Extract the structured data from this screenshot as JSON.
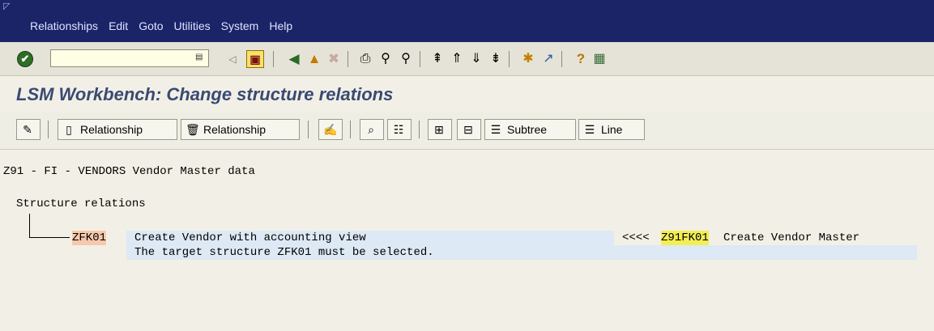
{
  "menubar": {
    "items": [
      {
        "label": "Relationships"
      },
      {
        "label": "Edit"
      },
      {
        "label": "Goto"
      },
      {
        "label": "Utilities"
      },
      {
        "label": "System"
      },
      {
        "label": "Help"
      }
    ]
  },
  "std_toolbar": {
    "command_field_value": "",
    "icons": [
      "enter-icon",
      "save-icon",
      "back-icon",
      "exit-icon",
      "cancel-icon",
      "print-icon",
      "find-icon",
      "find-next-icon",
      "first-page-icon",
      "previous-page-icon",
      "next-page-icon",
      "last-page-icon",
      "create-session-icon",
      "shortcut-icon",
      "help-icon",
      "layout-menu-icon"
    ]
  },
  "title": "LSM Workbench: Change structure relations",
  "app_toolbar": {
    "create_relationship": "Relationship",
    "delete_relationship": "Relationship",
    "subtree": "Subtree",
    "line": "Line"
  },
  "content": {
    "header": "Z91 - FI - VENDORS Vendor Master data",
    "section": "Structure relations",
    "target_code": "ZFK01",
    "target_desc": "Create Vendor with accounting view",
    "arrow": "<<<<",
    "source_code": "Z91FK01",
    "source_desc": "Create Vendor Master",
    "message": "The target structure ZFK01 must be selected."
  },
  "colors": {
    "menubar_bg": "#1b2467",
    "title_color": "#3a4a73",
    "target_highlight": "#f7c9ac",
    "source_highlight": "#f3ee55",
    "row_highlight": "#dde9f5"
  }
}
